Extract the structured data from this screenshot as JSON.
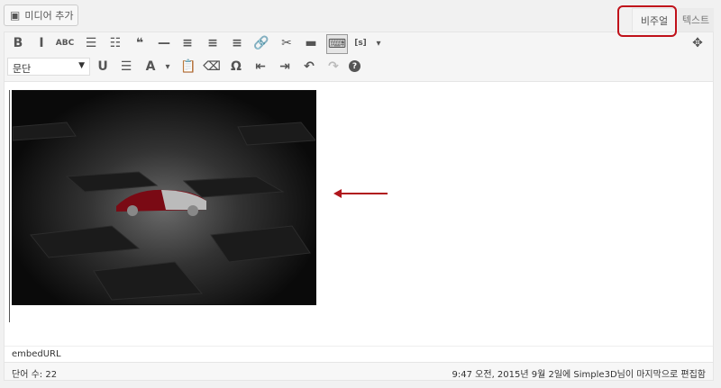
{
  "media_button": {
    "label": "미디어 추가",
    "icon": "media-icon"
  },
  "tabs": {
    "visual": "비주얼",
    "text": "텍스트",
    "active": "visual",
    "highlight_color": "#c0111a"
  },
  "toolbar": {
    "row1": [
      {
        "icon": "bold-icon",
        "glyph": "B"
      },
      {
        "icon": "italic-icon",
        "glyph": "I"
      },
      {
        "icon": "strikethrough-icon",
        "glyph": "ABC"
      },
      {
        "icon": "bulleted-list-icon",
        "glyph": "☰"
      },
      {
        "icon": "numbered-list-icon",
        "glyph": "☷"
      },
      {
        "icon": "blockquote-icon",
        "glyph": "❝"
      },
      {
        "icon": "horizontal-line-icon",
        "glyph": "—"
      },
      {
        "icon": "align-left-icon",
        "glyph": "≡"
      },
      {
        "icon": "align-center-icon",
        "glyph": "≡"
      },
      {
        "icon": "align-right-icon",
        "glyph": "≡"
      },
      {
        "icon": "link-icon",
        "glyph": "🔗"
      },
      {
        "icon": "unlink-icon",
        "glyph": "✂"
      },
      {
        "icon": "read-more-icon",
        "glyph": "▬"
      },
      {
        "icon": "toolbar-toggle-icon",
        "glyph": "⌨"
      },
      {
        "icon": "shortcode-icon",
        "glyph": "[s]"
      },
      {
        "icon": "dropdown-arrow-icon",
        "glyph": "▾"
      }
    ],
    "fullscreen_icon": "✥",
    "format_select": "문단",
    "row2": [
      {
        "icon": "underline-icon",
        "glyph": "U"
      },
      {
        "icon": "justify-icon",
        "glyph": "☰"
      },
      {
        "icon": "text-color-icon",
        "glyph": "A"
      },
      {
        "icon": "dropdown-arrow-icon",
        "glyph": "▾"
      },
      {
        "icon": "paste-text-icon",
        "glyph": "📋"
      },
      {
        "icon": "clear-formatting-icon",
        "glyph": "⌫"
      },
      {
        "icon": "special-character-icon",
        "glyph": "Ω"
      },
      {
        "icon": "outdent-icon",
        "glyph": "⇤"
      },
      {
        "icon": "indent-icon",
        "glyph": "⇥"
      },
      {
        "icon": "undo-icon",
        "glyph": "↶"
      },
      {
        "icon": "redo-icon",
        "glyph": "↷"
      },
      {
        "icon": "help-icon",
        "glyph": "?"
      }
    ]
  },
  "arrow_color": "#b0161c",
  "path": "embedURL",
  "word_count": "단어 수: 22",
  "last_edited": "9:47 오전, 2015년 9월 2일에 Simple3D님이 마지막으로 편집함"
}
